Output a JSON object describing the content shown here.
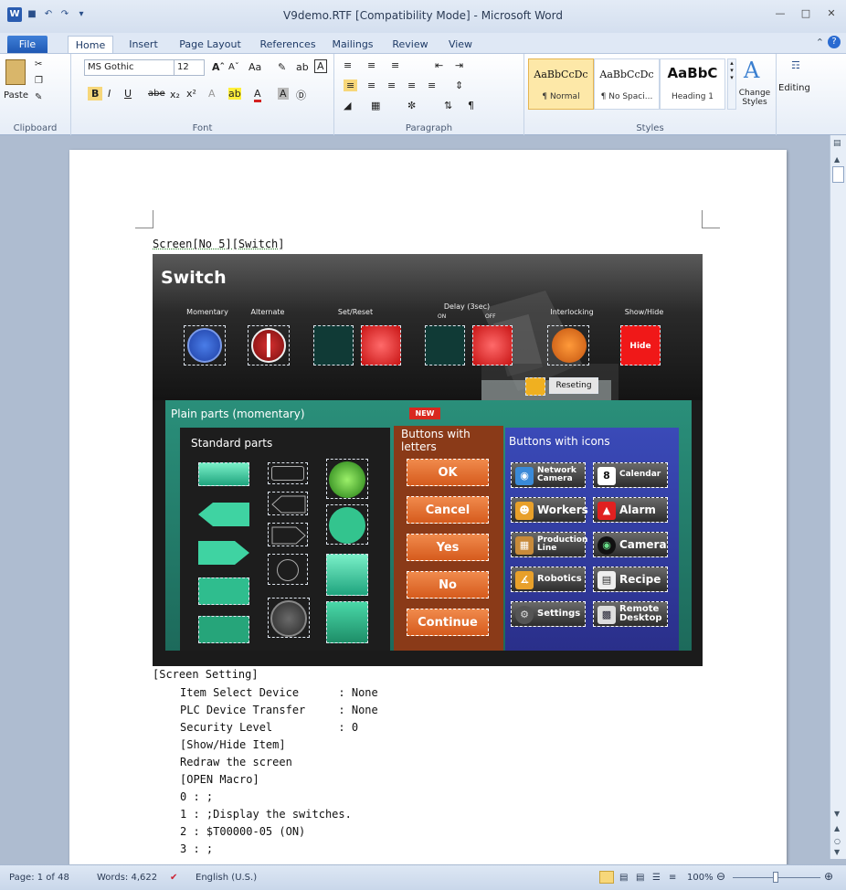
{
  "window": {
    "title": "V9demo.RTF [Compatibility Mode] - Microsoft Word",
    "app_icon": "W"
  },
  "tabs": [
    {
      "label": "File"
    },
    {
      "label": "Home"
    },
    {
      "label": "Insert"
    },
    {
      "label": "Page Layout"
    },
    {
      "label": "References"
    },
    {
      "label": "Mailings"
    },
    {
      "label": "Review"
    },
    {
      "label": "View"
    }
  ],
  "ribbon": {
    "clipboard": {
      "paste": "Paste",
      "label": "Clipboard"
    },
    "font": {
      "name": "MS Gothic",
      "size": "12",
      "label": "Font"
    },
    "paragraph": {
      "label": "Paragraph"
    },
    "styles": {
      "label": "Styles",
      "tiles": [
        {
          "preview": "AaBbCcDc",
          "name": "¶ Normal"
        },
        {
          "preview": "AaBbCcDc",
          "name": "¶ No Spaci..."
        },
        {
          "preview": "AaBbC",
          "name": "Heading 1"
        }
      ],
      "change_styles": "Change Styles"
    },
    "editing": {
      "label": "Editing"
    }
  },
  "doc": {
    "heading": "Screen[No 5][Switch]",
    "hmi": {
      "title": "Switch",
      "top_labels": [
        "Momentary",
        "Alternate",
        "Set/Reset",
        "Delay (3sec)",
        "Interlocking",
        "Show/Hide"
      ],
      "delay_on": "ON",
      "delay_off": "OFF",
      "hide": "Hide",
      "reseting": "Reseting",
      "plain_parts": "Plain parts (momentary)",
      "new_badge": "NEW",
      "standard_parts": "Standard parts",
      "buttons_letters": "Buttons with letters",
      "buttons_icons": "Buttons with icons",
      "letter_buttons": [
        "OK",
        "Cancel",
        "Yes",
        "No",
        "Continue"
      ],
      "icon_buttons": [
        {
          "label": "Network Camera",
          "icon": "camera-icon"
        },
        {
          "label": "Calendar",
          "icon": "calendar-icon"
        },
        {
          "label": "Workers",
          "icon": "workers-icon"
        },
        {
          "label": "Alarm",
          "icon": "alarm-icon"
        },
        {
          "label": "Production Line",
          "icon": "production-line-icon"
        },
        {
          "label": "Camera",
          "icon": "lens-icon"
        },
        {
          "label": "Robotics",
          "icon": "robot-arm-icon"
        },
        {
          "label": "Recipe",
          "icon": "recipe-icon"
        },
        {
          "label": "Settings",
          "icon": "gear-icon"
        },
        {
          "label": "Remote Desktop",
          "icon": "monitor-icon"
        }
      ]
    },
    "settings": {
      "header": "[Screen Setting]",
      "lines": [
        "Item Select Device      : None",
        "PLC Device Transfer     : None",
        "Security Level          : 0",
        "[Show/Hide Item]",
        "Redraw the screen",
        "[OPEN Macro]",
        "0 : ;",
        "1 : ;Display the switches.",
        "2 : $T00000-05 (ON)",
        "3 : ;"
      ]
    }
  },
  "status": {
    "page": "Page: 1 of 48",
    "words": "Words: 4,622",
    "language": "English (U.S.)",
    "zoom": "100%"
  }
}
